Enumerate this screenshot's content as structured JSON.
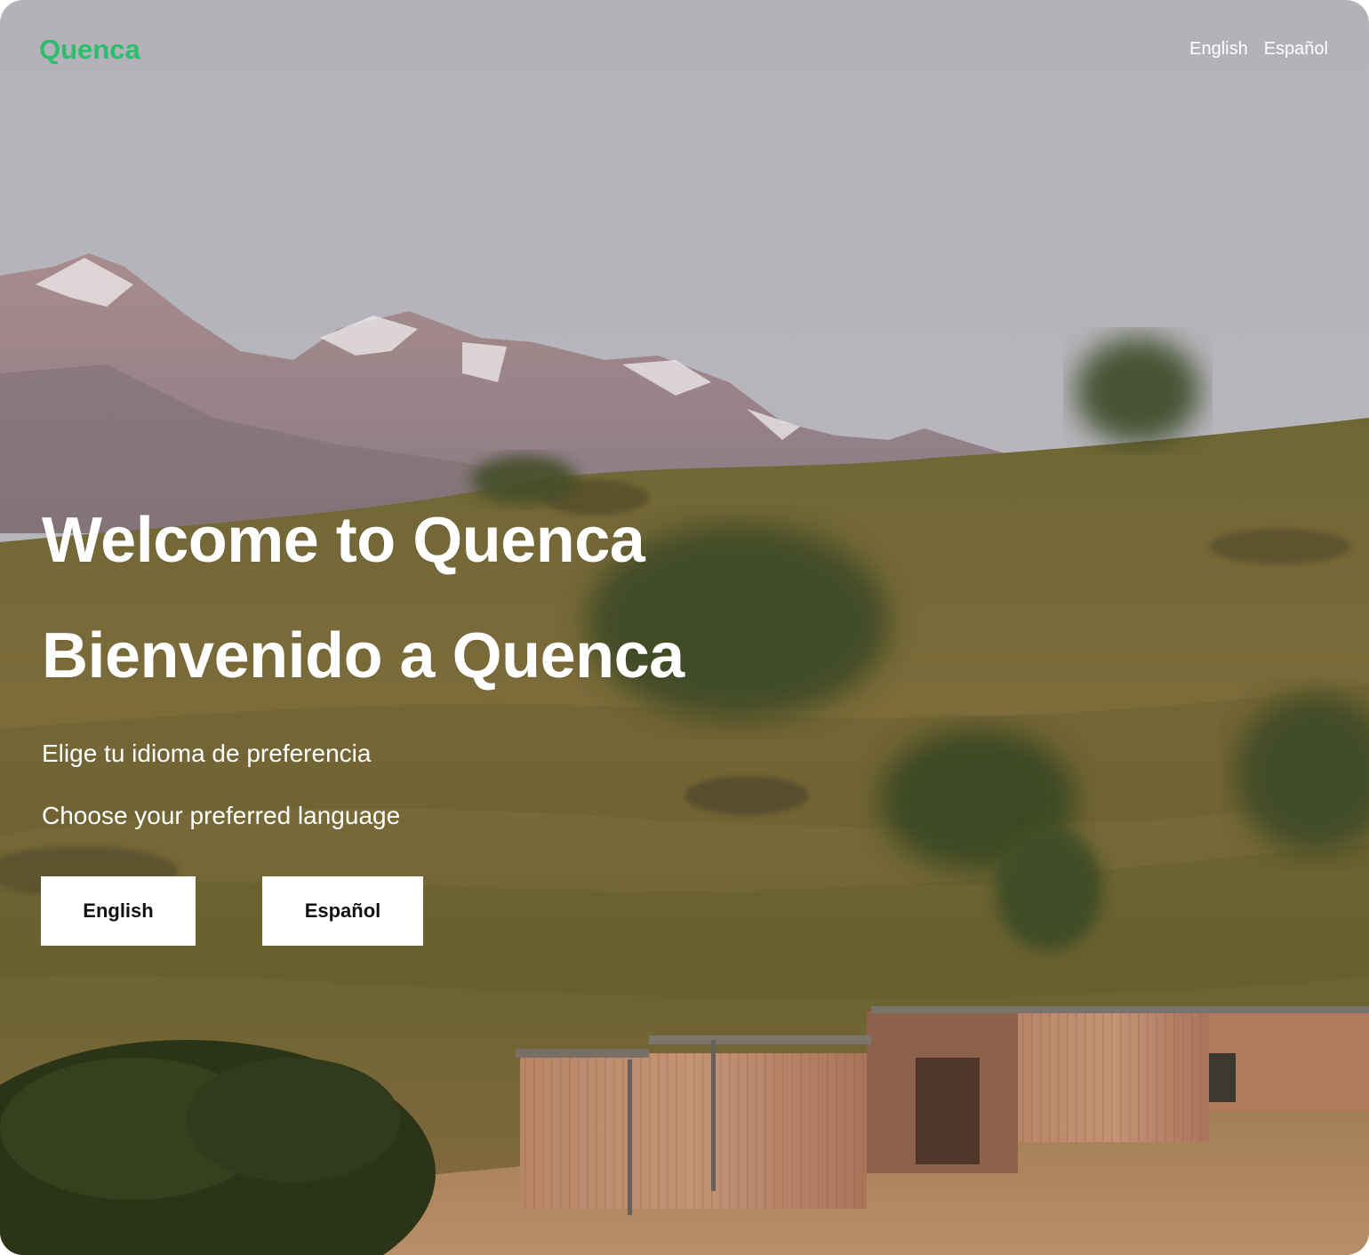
{
  "brand": {
    "logo_text": "Quenca",
    "logo_color": "#2dbd6e"
  },
  "nav": {
    "languages": [
      "English",
      "Español"
    ]
  },
  "hero": {
    "title_en": "Welcome to Quenca",
    "title_es": "Bienvenido a Quenca",
    "subtitle_es": "Elige tu idioma de preferencia",
    "subtitle_en": "Choose your preferred language"
  },
  "buttons": {
    "english_label": "English",
    "spanish_label": "Español"
  },
  "background": {
    "icon": "landscape-photo",
    "sky_color": "#b4b4b9",
    "hill_color": "#7a6a3a",
    "cabin_color": "#b47f63"
  }
}
